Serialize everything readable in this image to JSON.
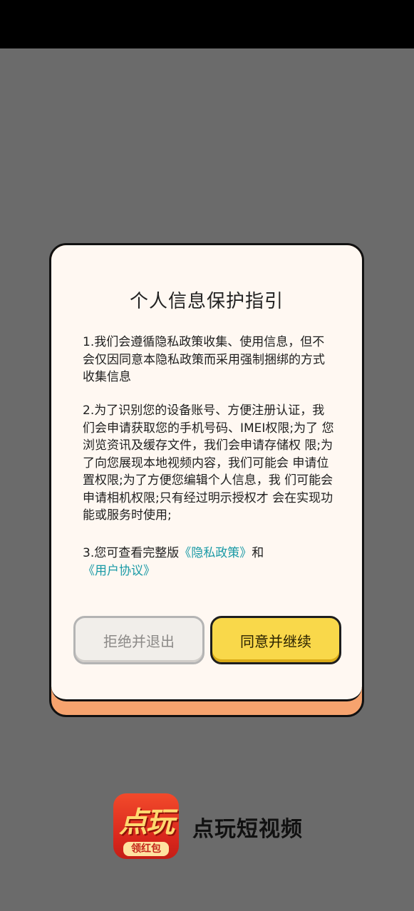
{
  "dialog": {
    "title": "个人信息保护指引",
    "para1": "1.我们会遵循隐私政策收集、使用信息，但不会仅因同意本隐私政策而采用强制捆绑的方式收集信息",
    "para2": "2.为了识别您的设备账号、方便注册认证，我 们会申请获取您的手机号码、IMEI权限;为了 您浏览资讯及缓存文件，我们会申请存储权 限;为了向您展现本地视频内容，我们可能会 申请位置权限;为了方便您编辑个人信息，我 们可能会申请相机权限;只有经过明示授权才 会在实现功能或服务时使用;",
    "para3_prefix": "3.您可查看完整版",
    "privacy_link": "《隐私政策》",
    "para3_and": "和",
    "agreement_link": "《用户协议》",
    "reject_label": "拒绝并退出",
    "agree_label": "同意并继续"
  },
  "app": {
    "logo_main": "点玩",
    "logo_sub": "领红包",
    "name": "点玩短视频"
  },
  "colors": {
    "overlay": "#6b6b6b",
    "dialog_bg": "#fff8f2",
    "dialog_shadow": "#f6a36e",
    "agree_button": "#f9d84a",
    "link": "#1a9aa6"
  }
}
